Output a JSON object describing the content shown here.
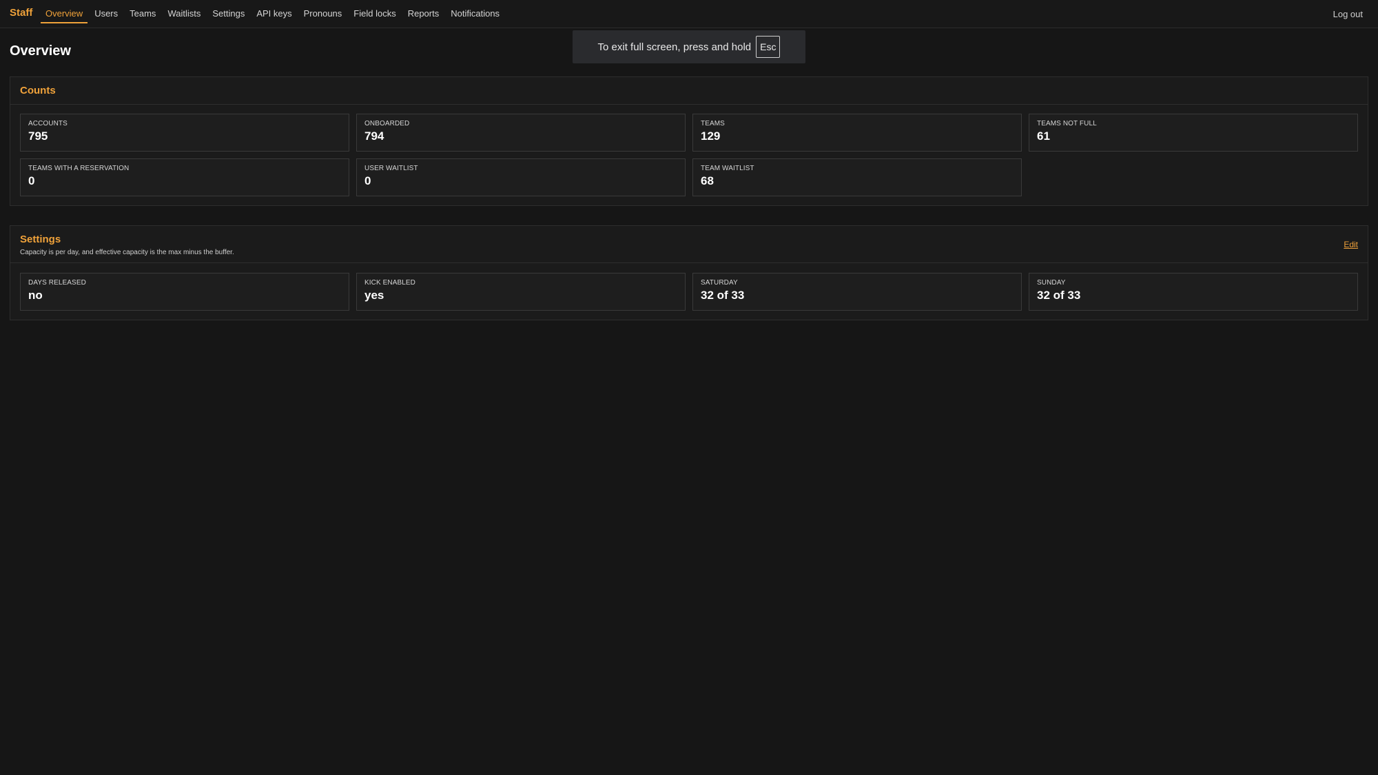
{
  "nav": {
    "brand": "Staff",
    "items": [
      {
        "label": "Overview",
        "active": true
      },
      {
        "label": "Users"
      },
      {
        "label": "Teams"
      },
      {
        "label": "Waitlists"
      },
      {
        "label": "Settings"
      },
      {
        "label": "API keys"
      },
      {
        "label": "Pronouns"
      },
      {
        "label": "Field locks"
      },
      {
        "label": "Reports"
      },
      {
        "label": "Notifications"
      }
    ],
    "logout": "Log out"
  },
  "toast": {
    "text": "To exit full screen, press and hold",
    "key": "Esc"
  },
  "page": {
    "title": "Overview"
  },
  "counts": {
    "title": "Counts",
    "stats": [
      {
        "label": "ACCOUNTS",
        "value": "795"
      },
      {
        "label": "ONBOARDED",
        "value": "794"
      },
      {
        "label": "TEAMS",
        "value": "129"
      },
      {
        "label": "TEAMS NOT FULL",
        "value": "61"
      },
      {
        "label": "TEAMS WITH A RESERVATION",
        "value": "0"
      },
      {
        "label": "USER WAITLIST",
        "value": "0"
      },
      {
        "label": "TEAM WAITLIST",
        "value": "68"
      }
    ]
  },
  "settings": {
    "title": "Settings",
    "subtitle": "Capacity is per day, and effective capacity is the max minus the buffer.",
    "edit": "Edit",
    "stats": [
      {
        "label": "DAYS RELEASED",
        "value": "no"
      },
      {
        "label": "KICK ENABLED",
        "value": "yes"
      },
      {
        "label": "SATURDAY",
        "value": "32 of 33"
      },
      {
        "label": "SUNDAY",
        "value": "32 of 33"
      }
    ]
  },
  "colors": {
    "accent": "#f0a23a",
    "background": "#161616"
  }
}
